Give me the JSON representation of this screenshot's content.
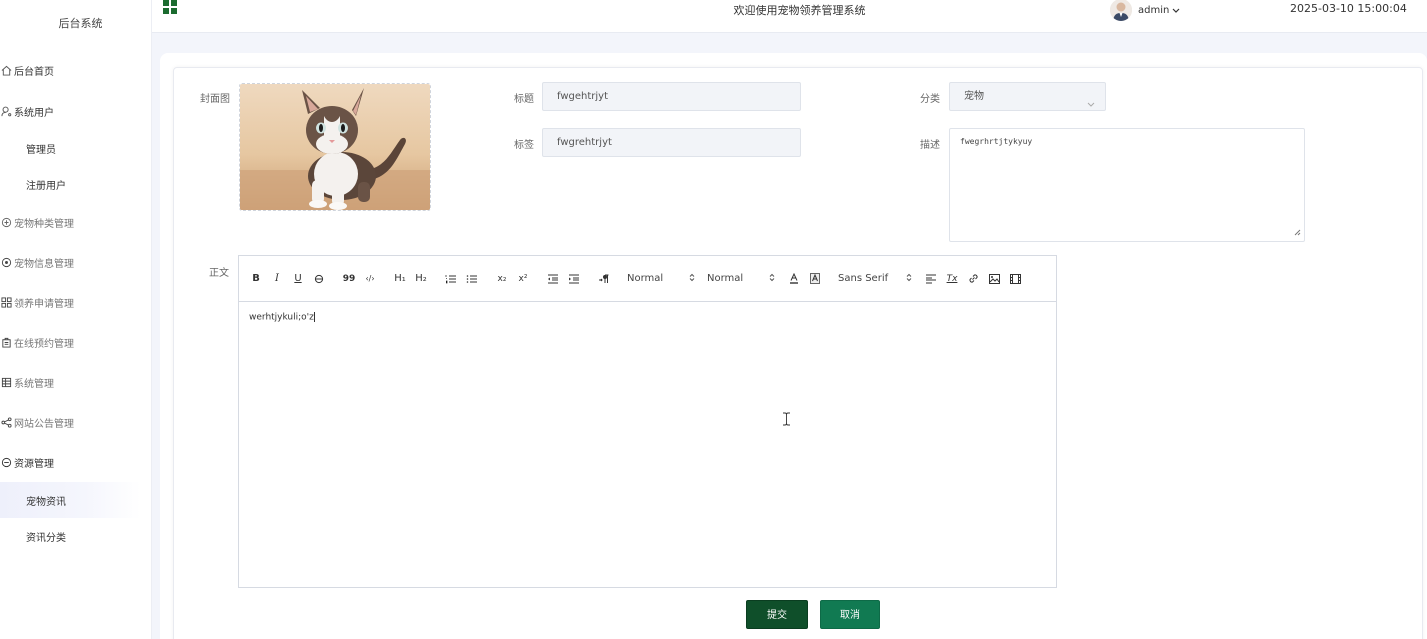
{
  "sidebar": {
    "logo": "后台系统",
    "items": [
      {
        "label": "后台首页",
        "icon": "home-icon",
        "type": "top"
      },
      {
        "label": "系统用户",
        "icon": "user-icon",
        "type": "top"
      },
      {
        "label": "管理员",
        "type": "sub"
      },
      {
        "label": "注册用户",
        "type": "sub"
      },
      {
        "label": "宠物种类管理",
        "icon": "paw-icon",
        "type": "top-muted"
      },
      {
        "label": "宠物信息管理",
        "icon": "info-icon",
        "type": "top-muted"
      },
      {
        "label": "领养申请管理",
        "icon": "apps-icon",
        "type": "top-muted"
      },
      {
        "label": "在线预约管理",
        "icon": "clipboard-icon",
        "type": "top-muted"
      },
      {
        "label": "系统管理",
        "icon": "table-icon",
        "type": "top-muted"
      },
      {
        "label": "网站公告管理",
        "icon": "share-icon",
        "type": "top-muted"
      },
      {
        "label": "资源管理",
        "icon": "clock-icon",
        "type": "top"
      },
      {
        "label": "宠物资讯",
        "type": "sub-active"
      },
      {
        "label": "资讯分类",
        "type": "sub"
      }
    ]
  },
  "header": {
    "title": "欢迎使用宠物领养管理系统",
    "user": "admin",
    "datetime": "2025-03-10 15:00:04"
  },
  "form": {
    "cover_label": "封面图",
    "title_label": "标题",
    "title_value": "fwgehtrjyt",
    "tags_label": "标签",
    "tags_value": "fwgrehtrjyt",
    "category_label": "分类",
    "category_value": "宠物",
    "desc_label": "描述",
    "desc_value": "fwegrhrtjtykyuy",
    "body_label": "正文",
    "body_value": "werhtjykuli;o'z",
    "submit": "提交",
    "cancel": "取消"
  },
  "toolbar": {
    "bold": "B",
    "italic": "I",
    "underline": "U",
    "quote": "99",
    "code": "‹/›",
    "h1": "H₁",
    "h2": "H₂",
    "sub": "x₂",
    "sup": "x²",
    "size": "Normal",
    "header": "Normal",
    "font": "Sans Serif",
    "clean": "Tx"
  }
}
